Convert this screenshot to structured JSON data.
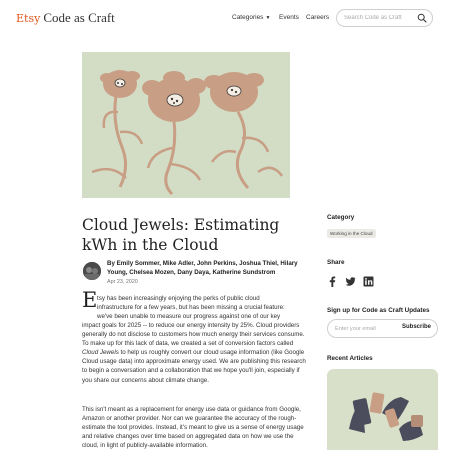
{
  "header": {
    "logo_brand": "Etsy",
    "logo_name": "Code as Craft",
    "nav": {
      "categories": "Categories",
      "events": "Events",
      "careers": "Careers"
    },
    "search_placeholder": "Search Code as Craft"
  },
  "hero": {
    "background_color": "#d3ddc6",
    "illustration_color": "#c89e84"
  },
  "article": {
    "title": "Cloud Jewels: Estimating kWh in the Cloud",
    "byline": "By Emily Sommer, Mike Adler, John Perkins, Joshua Thiel, Hilary Young, Chelsea Mozen, Dany Daya, Katherine Sundstrom",
    "date": "Apr 23, 2020",
    "dropcap": "E",
    "p1_lines": [
      "tsy has been increasingly enjoying the perks of public cloud",
      "infrastructure for a few years, but has been missing a crucial feature:",
      "we've been unable to measure our progress against one of our key"
    ],
    "p1_rest": "impact goals for 2025 -- to reduce our energy intensity by 25%. Cloud providers generally do not disclose to customers how much energy their services consume. To make up for this lack of data, we created a set of conversion factors called ",
    "p1_italic": "Cloud Jewels",
    "p1_end": " to help us roughly convert our cloud usage information (like Google Cloud usage data) into approximate energy used. We are publishing this research to begin a conversation and a collaboration that we hope you'll join, especially if you share our concerns about climate change.",
    "p2": "This isn't meant as a replacement for energy use data or guidance from Google, Amazon or another provider. Nor can we guarantee the accuracy of the rough-estimate the tool provides. Instead, it's meant to give us a sense of energy usage and relative changes over time based on aggregated data on how we use the cloud, in light of publicly-available information."
  },
  "sidebar": {
    "category_heading": "Category",
    "category_tag": "Working in the Cloud",
    "share_heading": "Share",
    "share_icons": [
      "facebook-icon",
      "twitter-icon",
      "linkedin-icon"
    ],
    "signup_heading": "Sign up for Code as Craft Updates",
    "email_placeholder": "Enter your email",
    "subscribe_label": "Subscribe",
    "recent_heading": "Recent Articles"
  }
}
